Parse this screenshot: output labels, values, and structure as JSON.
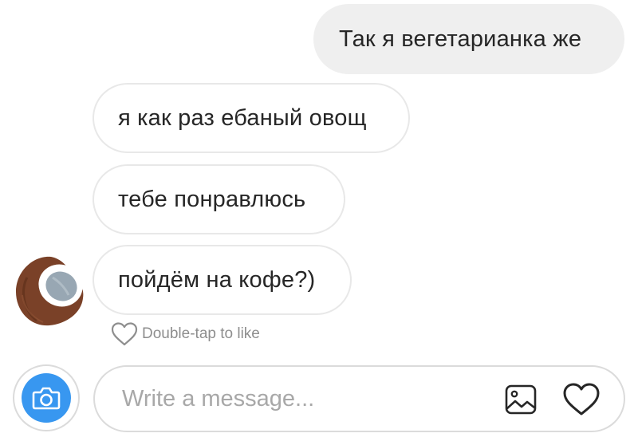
{
  "messages": {
    "outgoing": [
      {
        "text": "Так я вегетарианка же"
      }
    ],
    "incoming": [
      {
        "text": "я как раз ебаный овощ"
      },
      {
        "text": "тебе понравлюсь"
      },
      {
        "text": "пойдём на кофе?)"
      }
    ]
  },
  "sender": {
    "avatar_icon": "coconut-avatar"
  },
  "like_hint": {
    "icon": "heart-outline-icon",
    "text": "Double-tap to like"
  },
  "composer": {
    "value": "",
    "placeholder": "Write a message...",
    "camera_icon": "camera-icon",
    "gallery_icon": "image-icon",
    "like_icon": "heart-icon"
  },
  "colors": {
    "accent_blue": "#3897f0",
    "outgoing_bubble": "#efefef",
    "border": "#dbdbdb",
    "placeholder": "#a8a8a8",
    "muted_text": "#8e8e8e"
  }
}
